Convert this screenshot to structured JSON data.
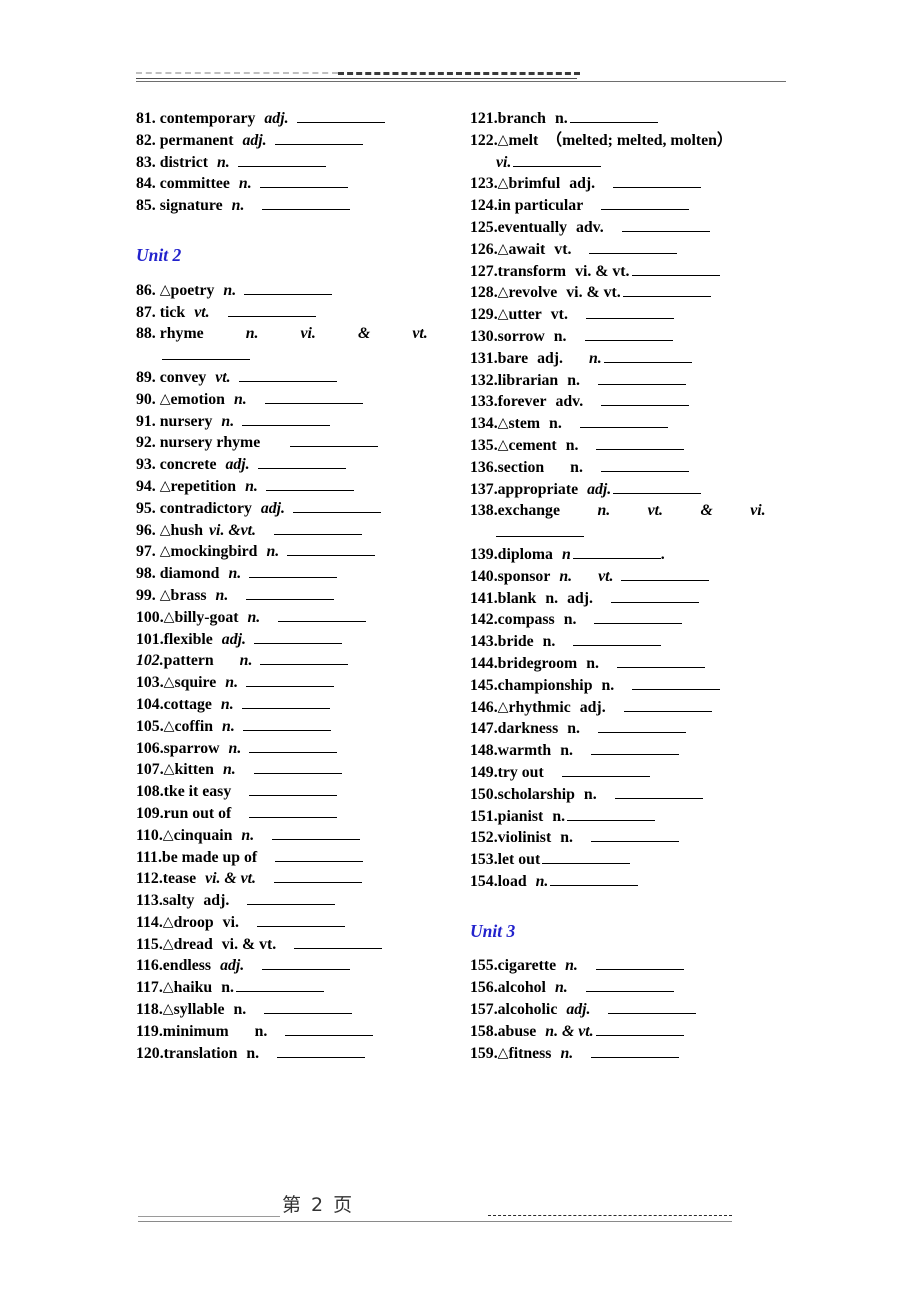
{
  "document": {
    "page_footer_label": "第 2 页",
    "heading_color": "#2222cc",
    "text_color": "#000000"
  },
  "units": [
    {
      "id": "unit2",
      "label": "Unit 2"
    },
    {
      "id": "unit3",
      "label": "Unit 3"
    }
  ],
  "columns": {
    "left": [
      {
        "num": "81.",
        "mark": "",
        "word": "contemporary",
        "pos": "adj."
      },
      {
        "num": "82.",
        "mark": "",
        "word": "permanent",
        "pos": "adj."
      },
      {
        "num": "83.",
        "mark": "",
        "word": "district",
        "pos": "n."
      },
      {
        "num": "84.",
        "mark": "",
        "word": "committee",
        "pos": "n."
      },
      {
        "num": "85.",
        "mark": "",
        "word": "signature",
        "pos": "n."
      },
      {
        "num": "86.",
        "mark": "△",
        "word": "poetry",
        "pos": "n."
      },
      {
        "num": "87.",
        "mark": "",
        "word": "tick",
        "pos": "vt."
      },
      {
        "num": "88.",
        "mark": "",
        "word": "rhyme",
        "pos": "n.",
        "pos2": "vi.",
        "pos3": "&",
        "pos4": "vt."
      },
      {
        "num": "89.",
        "mark": "",
        "word": "convey",
        "pos": "vt."
      },
      {
        "num": "90.",
        "mark": "△",
        "word": "emotion",
        "pos": "n."
      },
      {
        "num": "91.",
        "mark": "",
        "word": "nursery",
        "pos": "n."
      },
      {
        "num": "92.",
        "mark": "",
        "word": "nursery rhyme",
        "pos": ""
      },
      {
        "num": "93.",
        "mark": "",
        "word": "concrete",
        "pos": "adj."
      },
      {
        "num": "94.",
        "mark": "△",
        "word": "repetition",
        "pos": "n."
      },
      {
        "num": "95.",
        "mark": "",
        "word": "contradictory",
        "pos": "adj."
      },
      {
        "num": "96.",
        "mark": "△",
        "word": "hush",
        "pos": "vi. &vt."
      },
      {
        "num": "97.",
        "mark": "△",
        "word": "mockingbird",
        "pos": "n."
      },
      {
        "num": "98.",
        "mark": "",
        "word": "diamond",
        "pos": "n."
      },
      {
        "num": "99.",
        "mark": "△",
        "word": "brass",
        "pos": "n."
      },
      {
        "num": "100.",
        "mark": "△",
        "word": "billy-goat",
        "pos": "n."
      },
      {
        "num": "101.",
        "mark": "",
        "word": "flexible",
        "pos": "adj."
      },
      {
        "num": "102.",
        "mark": "",
        "word": "pattern",
        "pos": "n."
      },
      {
        "num": "103.",
        "mark": "△",
        "word": "squire",
        "pos": "n."
      },
      {
        "num": "104.",
        "mark": "",
        "word": "cottage",
        "pos": "n."
      },
      {
        "num": "105.",
        "mark": "△",
        "word": "coffin",
        "pos": "n."
      },
      {
        "num": "106.",
        "mark": "",
        "word": "sparrow",
        "pos": "n."
      },
      {
        "num": "107.",
        "mark": "△",
        "word": "kitten",
        "pos": "n."
      },
      {
        "num": "108.",
        "mark": "",
        "word": "tke it easy",
        "pos": ""
      },
      {
        "num": "109.",
        "mark": "",
        "word": "run out of",
        "pos": ""
      },
      {
        "num": "110.",
        "mark": "△",
        "word": "cinquain",
        "pos": "n."
      },
      {
        "num": "111.",
        "mark": "",
        "word": "be made up of",
        "pos": ""
      },
      {
        "num": "112.",
        "mark": "",
        "word": "tease",
        "pos": "vi. & vt."
      },
      {
        "num": "113.",
        "mark": "",
        "word": "salty",
        "pos": "adj."
      },
      {
        "num": "114.",
        "mark": "△",
        "word": "droop",
        "pos": "vi."
      },
      {
        "num": "115.",
        "mark": "△",
        "word": "dread",
        "pos": "vi. & vt."
      },
      {
        "num": "116.",
        "mark": "",
        "word": "endless",
        "pos": "adj."
      },
      {
        "num": "117.",
        "mark": "△",
        "word": "haiku",
        "pos": "n."
      },
      {
        "num": "118.",
        "mark": "△",
        "word": "syllable",
        "pos": "n."
      },
      {
        "num": "119.",
        "mark": "",
        "word": "minimum",
        "pos": "n."
      },
      {
        "num": "120.",
        "mark": "",
        "word": "translation",
        "pos": "n."
      }
    ],
    "right": [
      {
        "num": "121.",
        "mark": "",
        "word": "branch",
        "pos": "n."
      },
      {
        "num": "122.",
        "mark": "△",
        "word": "melt",
        "extra": "（melted; melted, molten）",
        "pos2": "vi."
      },
      {
        "num": "123.",
        "mark": "△",
        "word": "brimful",
        "pos": "adj."
      },
      {
        "num": "124.",
        "mark": "",
        "word": "in particular",
        "pos": ""
      },
      {
        "num": "125.",
        "mark": "",
        "word": "eventually",
        "pos": "adv."
      },
      {
        "num": "126.",
        "mark": "△",
        "word": "await",
        "pos": "vt."
      },
      {
        "num": "127.",
        "mark": "",
        "word": "transform",
        "pos": "vi. & vt."
      },
      {
        "num": "128.",
        "mark": "△",
        "word": "revolve",
        "pos": "vi. & vt."
      },
      {
        "num": "129.",
        "mark": "△",
        "word": "utter",
        "pos": "vt."
      },
      {
        "num": "130.",
        "mark": "",
        "word": "sorrow",
        "pos": "n."
      },
      {
        "num": "131.",
        "mark": "",
        "word": "bare",
        "pos": "adj.",
        "pos2": "n."
      },
      {
        "num": "132.",
        "mark": "",
        "word": "librarian",
        "pos": "n."
      },
      {
        "num": "133.",
        "mark": "",
        "word": "forever",
        "pos": "adv."
      },
      {
        "num": "134.",
        "mark": "△",
        "word": "stem",
        "pos": "n."
      },
      {
        "num": "135.",
        "mark": "△",
        "word": "cement",
        "pos": "n."
      },
      {
        "num": "136.",
        "mark": "",
        "word": "section",
        "pos": "n."
      },
      {
        "num": "137.",
        "mark": "",
        "word": "appropriate",
        "pos": "adj."
      },
      {
        "num": "138.",
        "mark": "",
        "word": "exchange",
        "pos": "n.",
        "pos2": "vt.",
        "pos3": "&",
        "pos4": "vi."
      },
      {
        "num": "139.",
        "mark": "",
        "word": "diploma",
        "pos": "n",
        "trailing": "."
      },
      {
        "num": "140.",
        "mark": "",
        "word": "sponsor",
        "pos": "n.",
        "pos2": "vt."
      },
      {
        "num": "141.",
        "mark": "",
        "word": "blank",
        "pos": "n.",
        "pos2": "adj."
      },
      {
        "num": "142.",
        "mark": "",
        "word": "compass",
        "pos": "n."
      },
      {
        "num": "143.",
        "mark": "",
        "word": "bride",
        "pos": "n."
      },
      {
        "num": "144.",
        "mark": "",
        "word": "bridegroom",
        "pos": "n."
      },
      {
        "num": "145.",
        "mark": "",
        "word": "championship",
        "pos": "n."
      },
      {
        "num": "146.",
        "mark": "△",
        "word": "rhythmic",
        "pos": "adj."
      },
      {
        "num": "147.",
        "mark": "",
        "word": "darkness",
        "pos": "n."
      },
      {
        "num": "148.",
        "mark": "",
        "word": "warmth",
        "pos": "n."
      },
      {
        "num": "149.",
        "mark": "",
        "word": "try out",
        "pos": ""
      },
      {
        "num": "150.",
        "mark": "",
        "word": "scholarship",
        "pos": "n."
      },
      {
        "num": "151.",
        "mark": "",
        "word": "pianist",
        "pos": "n."
      },
      {
        "num": "152.",
        "mark": "",
        "word": "violinist",
        "pos": "n."
      },
      {
        "num": "153.",
        "mark": "",
        "word": "let out",
        "pos": ""
      },
      {
        "num": "154.",
        "mark": "",
        "word": "load",
        "pos": "n."
      },
      {
        "num": "155.",
        "mark": "",
        "word": "cigarette",
        "pos": "n."
      },
      {
        "num": "156.",
        "mark": "",
        "word": "alcohol",
        "pos": "n."
      },
      {
        "num": "157.",
        "mark": "",
        "word": "alcoholic",
        "pos": "adj."
      },
      {
        "num": "158.",
        "mark": "",
        "word": "abuse",
        "pos": "n. & vt."
      },
      {
        "num": "159.",
        "mark": "△",
        "word": "fitness",
        "pos": "n."
      }
    ]
  }
}
